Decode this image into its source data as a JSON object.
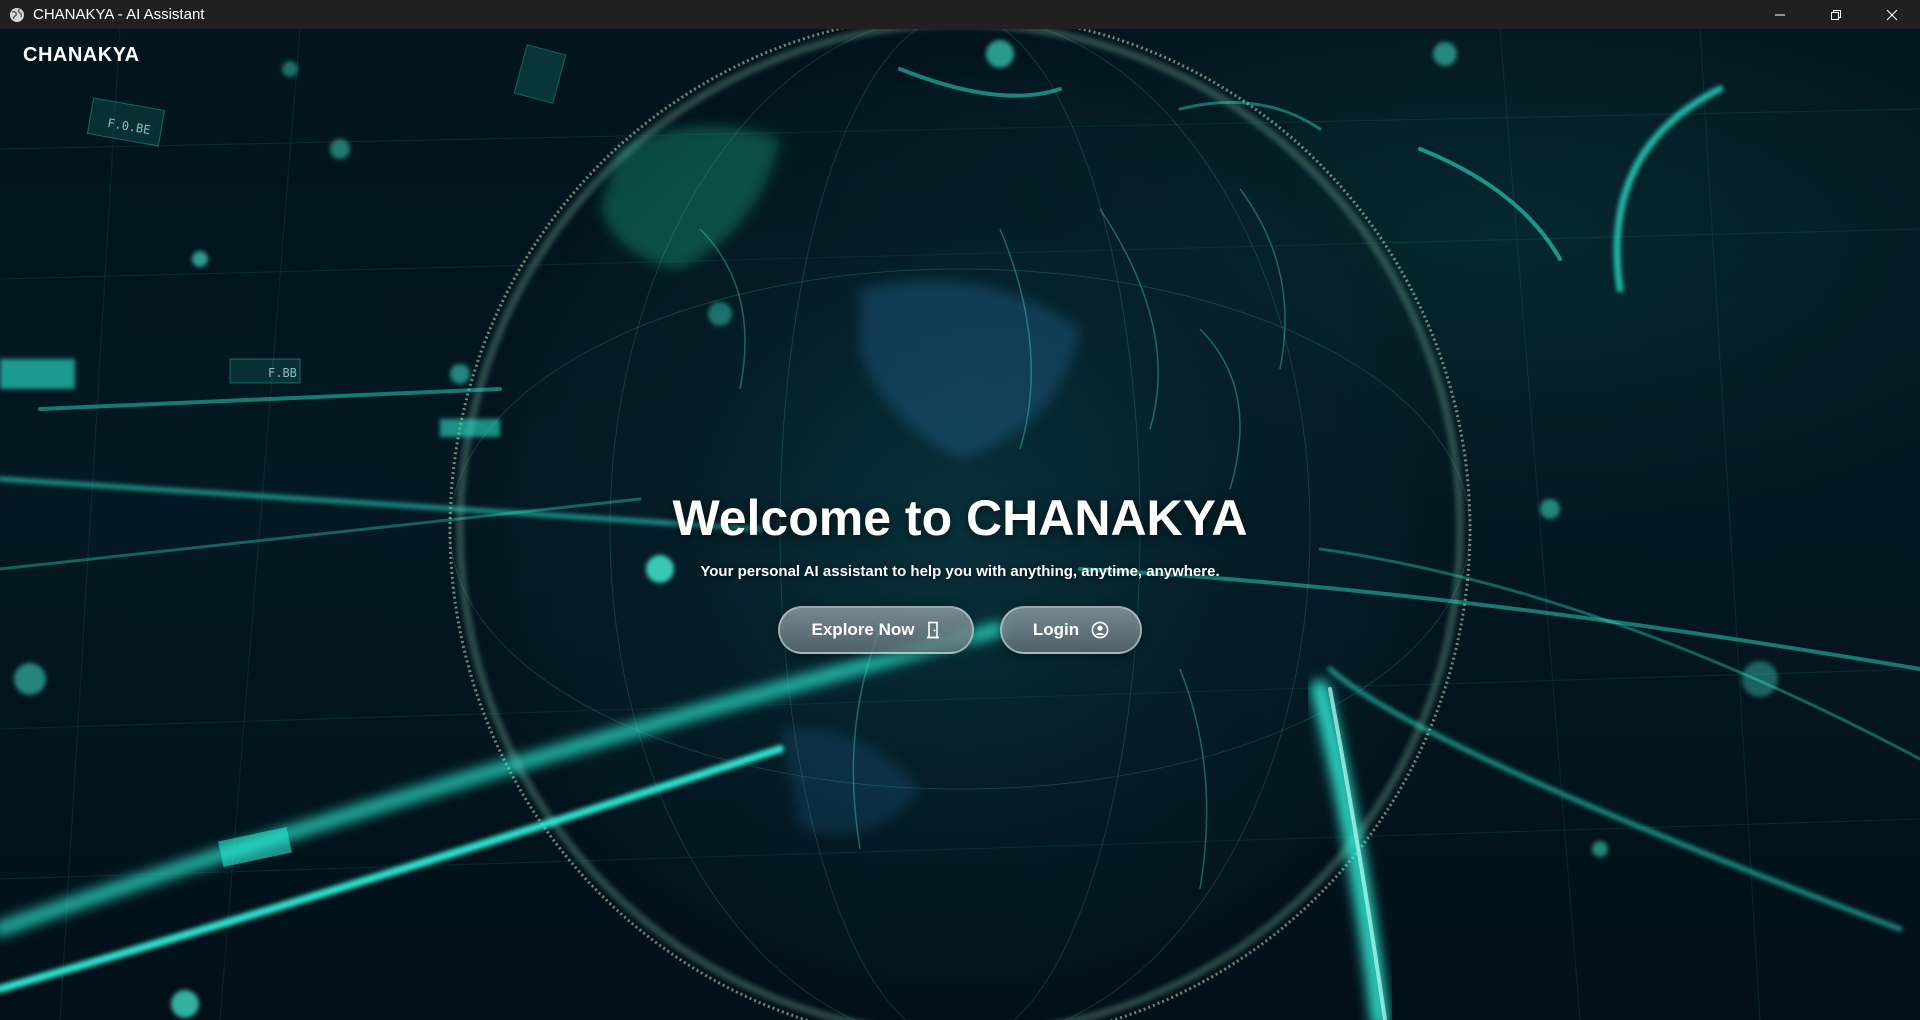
{
  "window": {
    "title": "CHANAKYA - AI Assistant",
    "app_icon": "globe-icon",
    "controls": [
      "minimize-icon",
      "restore-icon",
      "close-icon"
    ]
  },
  "header": {
    "brand": "CHANAKYA"
  },
  "hero": {
    "title": "Welcome to CHANAKYA",
    "subtitle": "Your personal AI assistant to help you with anything, anytime, anywhere.",
    "explore_label": "Explore Now",
    "explore_icon": "door-icon",
    "login_label": "Login",
    "login_icon": "user-circle-icon"
  },
  "colors": {
    "titlebar": "#202020",
    "background": "#030d14",
    "accent_cyan": "#2ef2d8",
    "button_fill": "#7f8e95"
  },
  "background_labels": [
    "F.0.BE",
    "F.BB"
  ]
}
